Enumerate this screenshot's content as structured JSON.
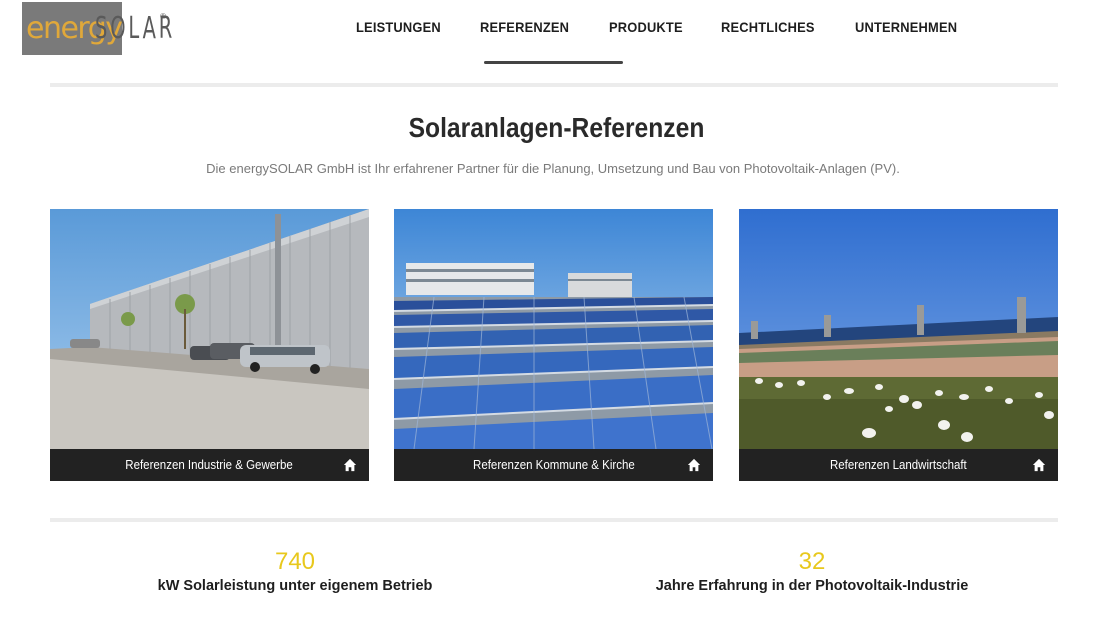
{
  "brand": {
    "logo_energy": "energy",
    "logo_solar": "SOLAR",
    "logo_reg": "®",
    "colors": {
      "energy": "#e0a83a",
      "solar": "#5a5a5a",
      "box": "#7a7a7a"
    }
  },
  "nav": {
    "items": [
      {
        "label": "LEISTUNGEN"
      },
      {
        "label": "REFERENZEN"
      },
      {
        "label": "PRODUKTE"
      },
      {
        "label": "RECHTLICHES"
      },
      {
        "label": "UNTERNEHMEN"
      }
    ],
    "active": "REFERENZEN"
  },
  "main": {
    "title": "Solaranlagen-Referenzen",
    "subtitle": "Die energySOLAR GmbH ist Ihr erfahrener Partner für die Planung, Umsetzung und Bau von Photovoltaik-Anlagen (PV).",
    "cards": [
      {
        "label": "Referenzen Industrie & Gewerbe",
        "icon": "home-icon"
      },
      {
        "label": "Referenzen Kommune & Kirche",
        "icon": "home-icon"
      },
      {
        "label": "Referenzen Landwirtschaft",
        "icon": "home-icon"
      }
    ]
  },
  "stats": [
    {
      "number": "740",
      "label": "kW Solarleistung unter eigenem Betrieb"
    },
    {
      "number": "32",
      "label": "Jahre Erfahrung in der Photovoltaik-Industrie"
    }
  ],
  "colors": {
    "accent_yellow": "#e8c81c",
    "card_footer": "#222222"
  }
}
